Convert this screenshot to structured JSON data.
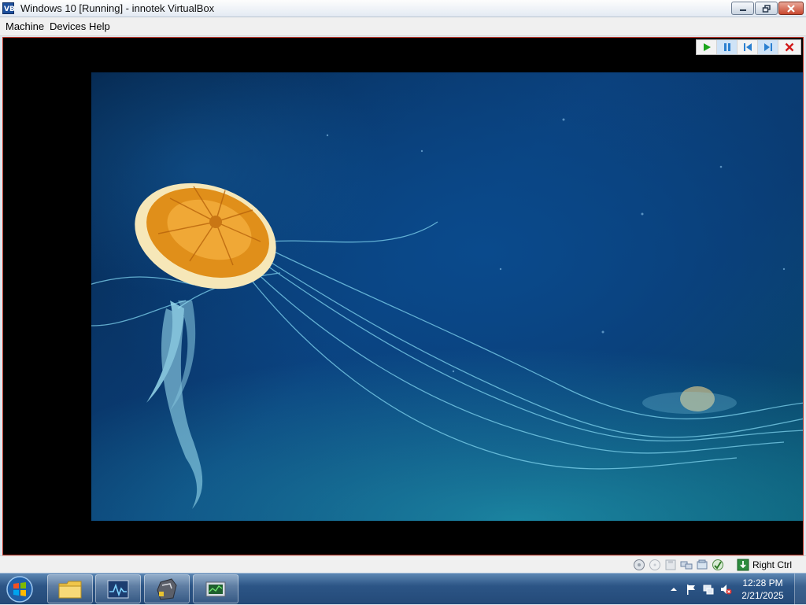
{
  "window": {
    "title": "Windows 10 [Running] - innotek VirtualBox",
    "icons": [
      "virtualbox-icon",
      "minimize-icon",
      "restore-icon",
      "close-icon"
    ]
  },
  "menu": {
    "items": [
      "Machine",
      "Devices",
      "Help"
    ]
  },
  "vm_controls": {
    "icons": [
      "play-icon",
      "pause-icon",
      "skip-back-icon",
      "skip-forward-icon",
      "close-x-icon"
    ]
  },
  "statusbar": {
    "icons": [
      "hard-disk-icon",
      "optical-drive-icon",
      "floppy-icon",
      "network-icon",
      "usb-icon",
      "shared-folder-icon",
      "mouse-integration-icon"
    ],
    "host_key": "Right Ctrl"
  },
  "taskbar": {
    "apps": [
      "start-orb-icon",
      "file-explorer-icon",
      "resource-monitor-icon",
      "virtualbox-app-icon",
      "task-manager-icon"
    ],
    "tray_icons": [
      "show-hidden-icons-arrow",
      "action-center-flag-icon",
      "network-tray-icon",
      "volume-muted-icon"
    ],
    "time": "12:28 PM",
    "date": "2/21/2025"
  },
  "colors": {
    "frame_border": "#c0392b",
    "vm_background": "#000000",
    "play_green": "#1aa51a",
    "pause_blue": "#2a7fd0",
    "close_red": "#d11a1a"
  }
}
